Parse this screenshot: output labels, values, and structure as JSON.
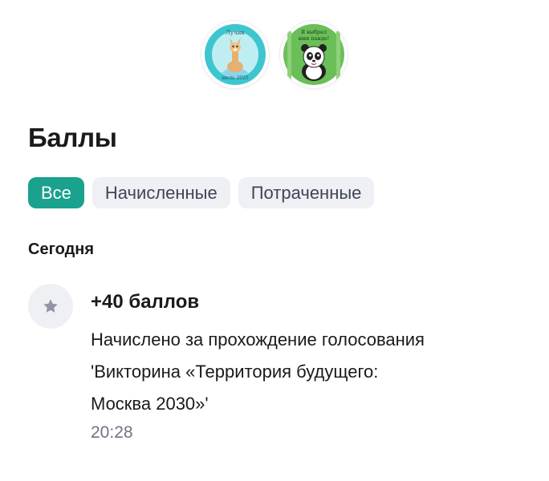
{
  "badges": [
    {
      "name": "Лучик",
      "top_text": "Лучик",
      "bottom_text": "июль 2025",
      "icon": "llama-icon",
      "bg": "#3ec6d0"
    },
    {
      "name": "Я выбрал имя панде!",
      "line1": "Я выбрал",
      "line2": "имя панде!",
      "icon": "panda-icon",
      "bg": "#6bbf59"
    }
  ],
  "page": {
    "title": "Баллы"
  },
  "filters": [
    {
      "label": "Все",
      "active": true
    },
    {
      "label": "Начисленные",
      "active": false
    },
    {
      "label": "Потраченные",
      "active": false
    }
  ],
  "section": {
    "title": "Сегодня"
  },
  "transactions": [
    {
      "icon": "star-icon",
      "amount": "+40 баллов",
      "description_lines": [
        "Начислено за прохождение голосования",
        "'Викторина «Территория будущего:",
        "Москва 2030»'"
      ],
      "time": "20:28"
    }
  ],
  "colors": {
    "accent": "#1aa28f",
    "chip_bg": "#eef0f4",
    "muted": "#6e7487"
  }
}
